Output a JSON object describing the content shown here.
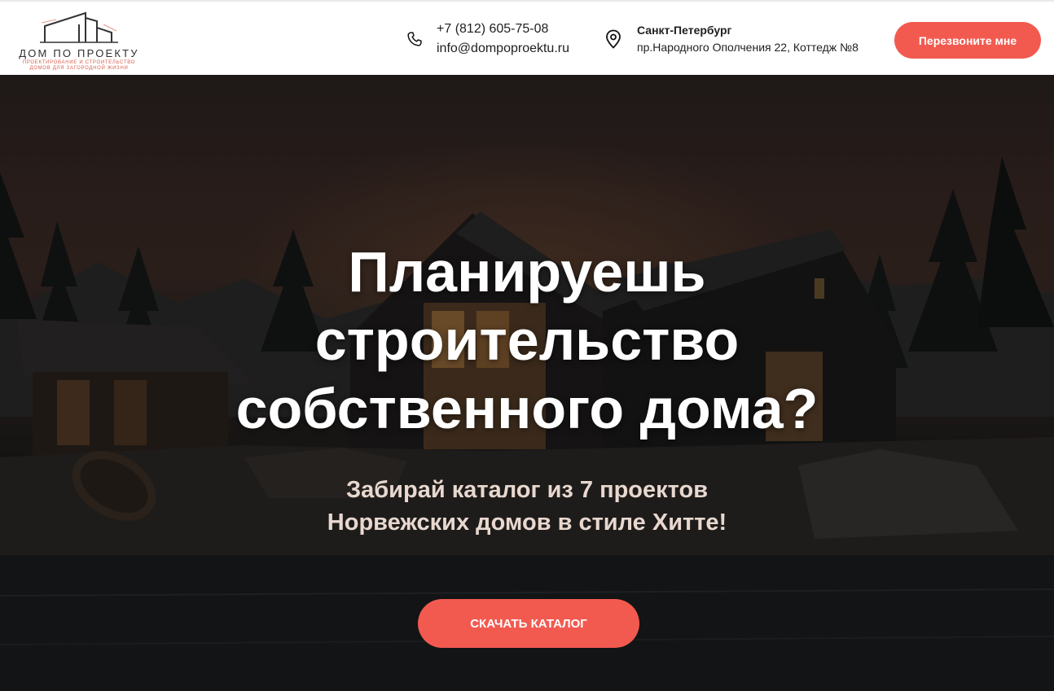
{
  "header": {
    "logo": {
      "name": "ДОМ ПО ПРОЕКТУ",
      "tagline_1": "ПРОЕКТИРОВАНИЕ И СТРОИТЕЛЬСТВО",
      "tagline_2": "ДОМОВ ДЛЯ ЗАГОРОДНОЙ ЖИЗНИ"
    },
    "phone": "+7 (812) 605-75-08",
    "email": "info@dompoproektu.ru",
    "city": "Санкт-Петербург",
    "address": "пр.Народного Ополчения 22, Коттедж №8",
    "callback_label": "Перезвоните мне"
  },
  "hero": {
    "title_line_1": "Планируешь",
    "title_line_2": "строительство",
    "title_line_3": "собственного дома?",
    "subtitle_line_1": "Забирай каталог из 7 проектов",
    "subtitle_line_2": "Норвежских домов в стиле Хитте!",
    "cta_label": "СКАЧАТЬ КАТАЛОГ"
  },
  "icons": {
    "phone": "phone-icon",
    "location": "map-pin-icon",
    "logo": "house-outline-logo"
  },
  "colors": {
    "accent": "#f25a50",
    "header_bg": "#ffffff",
    "text_dark": "#1f1f1f",
    "hero_text": "#ffffff",
    "hero_subtext": "#e8d8cf"
  }
}
